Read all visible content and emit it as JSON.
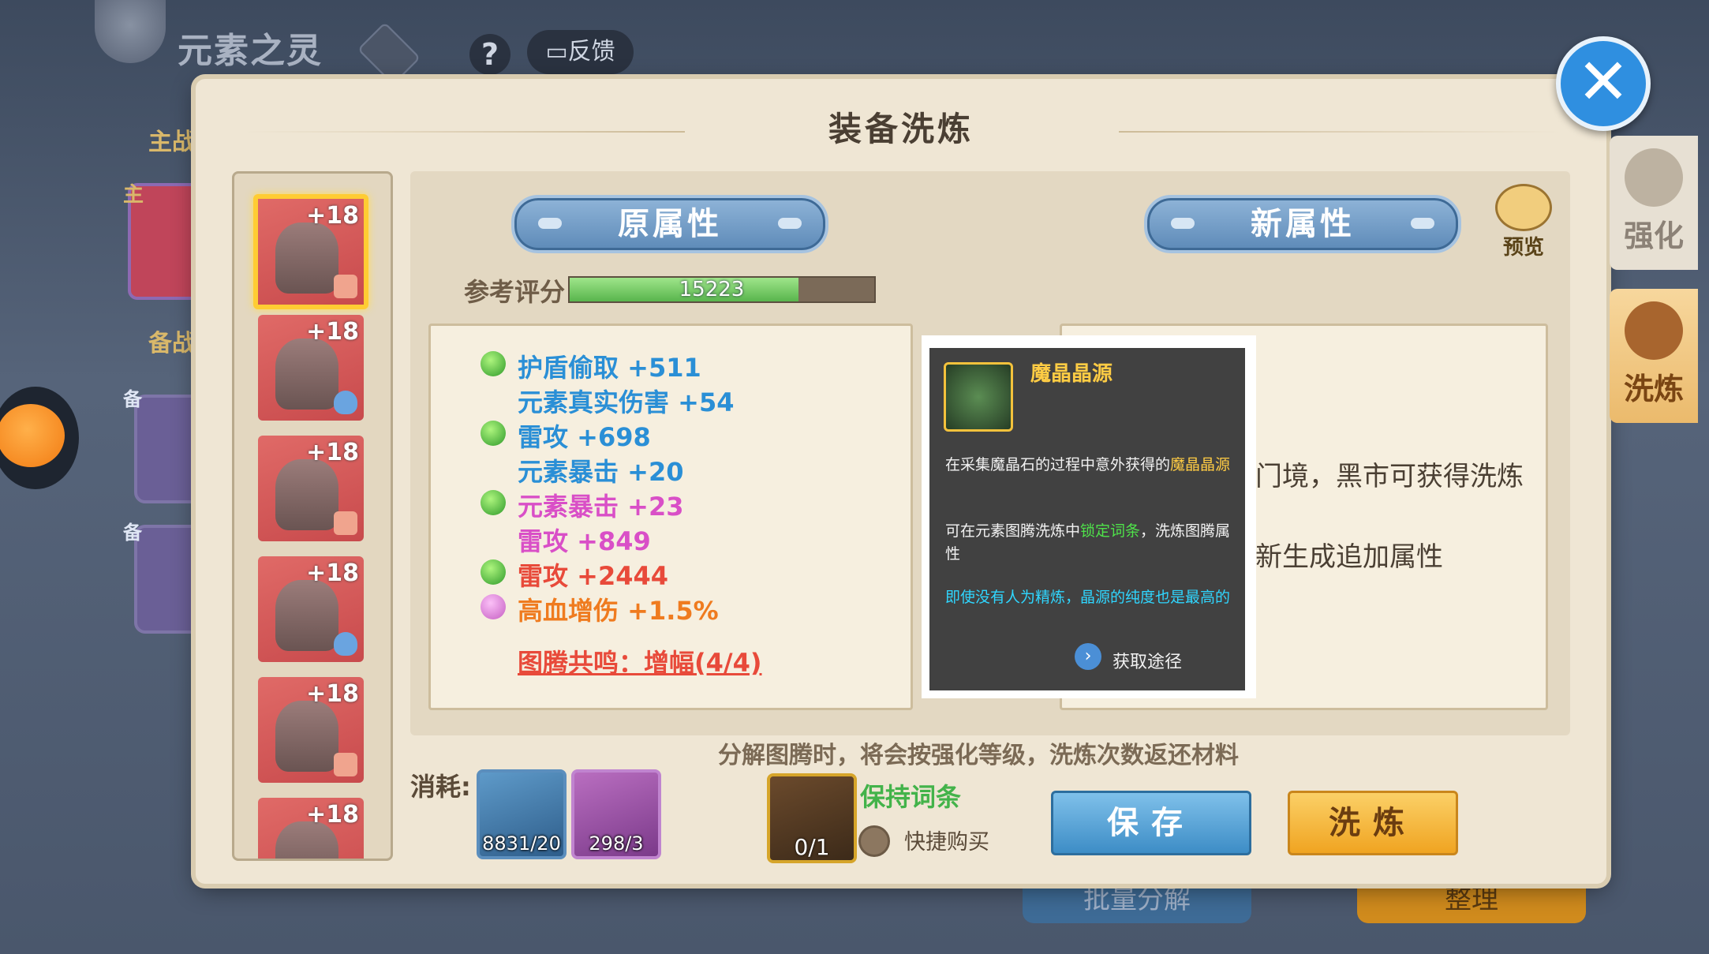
{
  "top_bar": {
    "game_title": "元素之灵",
    "help_label": "?",
    "feedback_label": "反馈"
  },
  "background": {
    "main_battle_label": "主战",
    "lead_tag": "主",
    "reserve_label": "备战",
    "reserve_tag_1": "备",
    "reserve_tag_2": "备",
    "batch_decompose_label": "批量分解",
    "organize_label": "整理"
  },
  "dialog": {
    "title": "装备洗炼",
    "close_label": "✕"
  },
  "equipment_list": [
    {
      "level": "+18",
      "selected": true,
      "badge": "sword"
    },
    {
      "level": "+18",
      "selected": false,
      "badge": "shield"
    },
    {
      "level": "+18",
      "selected": false,
      "badge": "sword"
    },
    {
      "level": "+18",
      "selected": false,
      "badge": "shield"
    },
    {
      "level": "+18",
      "selected": false,
      "badge": "sword"
    },
    {
      "level": "+18",
      "selected": false,
      "badge": ""
    }
  ],
  "original": {
    "header": "原属性",
    "score_label": "参考评分",
    "score_value": "15223",
    "score_fraction": 0.75,
    "attributes": [
      {
        "text": "护盾偷取  +511",
        "color": "#2a8fd6",
        "dot": "green"
      },
      {
        "text": "元素真实伤害  +54",
        "color": "#2a8fd6",
        "dot": ""
      },
      {
        "text": "雷攻  +698",
        "color": "#2a8fd6",
        "dot": "green"
      },
      {
        "text": "元素暴击  +20",
        "color": "#2a8fd6",
        "dot": ""
      },
      {
        "text": "元素暴击  +23",
        "color": "#d94fc7",
        "dot": "green"
      },
      {
        "text": "雷攻  +849",
        "color": "#d94fc7",
        "dot": ""
      },
      {
        "text": "雷攻  +2444",
        "color": "#e84a3a",
        "dot": "green"
      },
      {
        "text": "高血增伤  +1.5%",
        "color": "#ef7b1f",
        "dot": "purple"
      }
    ],
    "resonance": "图腾共鸣：增幅(4/4)"
  },
  "new_attrs": {
    "header": "新属性",
    "preview_label": "预览",
    "line1": "门境，黑市可获得洗炼",
    "line2": "新生成追加属性"
  },
  "tooltip": {
    "title": "魔晶晶源",
    "p1_pre": "在采集魔晶石的过程中意外获得的",
    "p1_hl": "魔晶晶源",
    "p2_pre": "可在元素图腾洗炼中",
    "p2_hl": "锁定词条",
    "p2_post": "，洗炼图腾属性",
    "p3": "即使没有人为精炼，晶源的纯度也是最高的",
    "link_label": "获取途径"
  },
  "bottom": {
    "notice": "分解图腾时，将会按强化等级，洗炼次数返还材料",
    "cost_label": "消耗:",
    "materials": [
      {
        "name": "crystal",
        "count": "8831/20"
      },
      {
        "name": "branch",
        "count": "298/3"
      }
    ],
    "lock_item_count": "0/1",
    "keep_label": "保持词条",
    "quick_buy_label": "快捷购买",
    "save_label": "保存",
    "refine_label": "洗炼"
  },
  "side_tabs": {
    "strengthen": "强化",
    "refine": "洗炼"
  },
  "colors": {
    "accent_blue": "#3d8dc6",
    "accent_gold": "#f0a421",
    "tooltip_title": "#ffcc44"
  }
}
